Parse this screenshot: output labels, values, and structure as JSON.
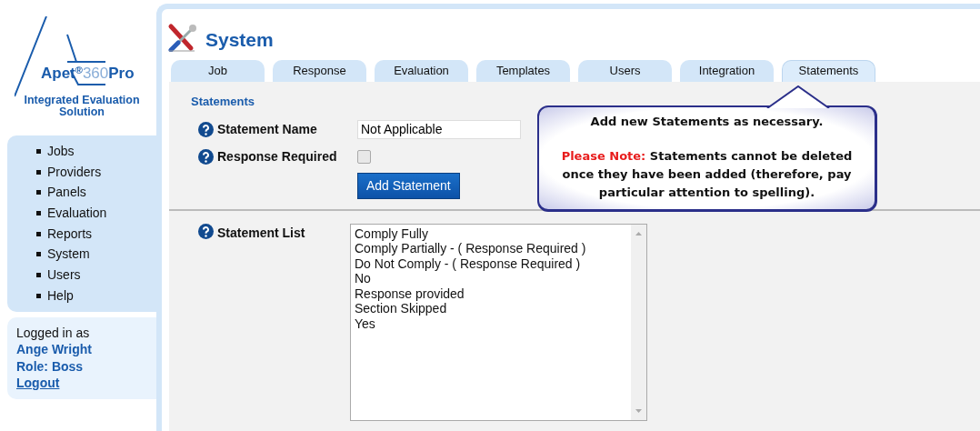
{
  "logo": {
    "brand": "Apet",
    "mark": "®",
    "version": "360",
    "suffix": "Pro",
    "tagline": "Integrated Evaluation Solution"
  },
  "sidebar": {
    "items": [
      "Jobs",
      "Providers",
      "Panels",
      "Evaluation",
      "Reports",
      "System",
      "Users",
      "Help"
    ]
  },
  "user_box": {
    "label": "Logged in as",
    "name": "Ange Wright",
    "role": "Role: Boss",
    "logout": "Logout"
  },
  "page": {
    "title": "System"
  },
  "tabs": [
    {
      "label": "Job",
      "selected": false
    },
    {
      "label": "Response",
      "selected": false
    },
    {
      "label": "Evaluation",
      "selected": false
    },
    {
      "label": "Templates",
      "selected": false
    },
    {
      "label": "Users",
      "selected": false
    },
    {
      "label": "Integration",
      "selected": false
    },
    {
      "label": "Statements",
      "selected": true
    }
  ],
  "section": {
    "heading": "Statements"
  },
  "form": {
    "name_label": "Statement Name",
    "name_value": "Not Applicable",
    "required_label": "Response Required",
    "required_checked": false,
    "button": "Add Statement"
  },
  "statement_list": {
    "label": "Statement List",
    "items": [
      "Comply Fully",
      "Comply Partially - ( Response Required )",
      "Do Not Comply - ( Response Required )",
      "No",
      "Response provided",
      "Section Skipped",
      "Yes"
    ]
  },
  "callout": {
    "line1": "Add new Statements as necessary.",
    "note": "**Please Note:** Statements cannot be deleted once they have been added (therefore, pay particular attention to spelling)."
  }
}
